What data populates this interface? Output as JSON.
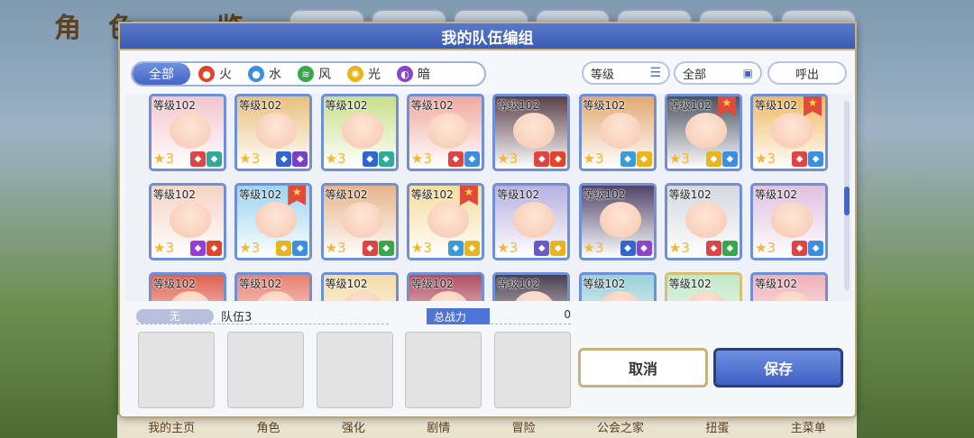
{
  "background": {
    "title": "角色一览",
    "nav": [
      "我的主页",
      "角色",
      "强化",
      "剧情",
      "冒险",
      "公会之家",
      "扭蛋",
      "主菜单"
    ]
  },
  "modal": {
    "title": "我的队伍编组",
    "elements": [
      {
        "label": "全部",
        "active": true
      },
      {
        "label": "火",
        "icon": "fire-icon",
        "color": "#e0452c"
      },
      {
        "label": "水",
        "icon": "water-icon",
        "color": "#3b8fe0"
      },
      {
        "label": "风",
        "icon": "wind-icon",
        "color": "#38a84a"
      },
      {
        "label": "光",
        "icon": "light-icon",
        "color": "#e8b420"
      },
      {
        "label": "暗",
        "icon": "dark-icon",
        "color": "#8a46c8"
      }
    ],
    "sort_label": "等级",
    "filter_label": "全部",
    "call_label": "呼出",
    "level_label": "等级102",
    "star_count": "3",
    "team_none": "无",
    "team_name": "队伍3",
    "power_label": "总战力",
    "power_value": "0",
    "cancel_label": "取消",
    "save_label": "保存"
  },
  "characters": [
    {
      "frame": "#6f8fd6",
      "bg": "#f2c6cf",
      "b": [
        "#d44",
        "#3a9"
      ],
      "flag": false
    },
    {
      "frame": "#6f8fd6",
      "bg": "#e8c07a",
      "b": [
        "#36c",
        "#7a3fc9"
      ],
      "flag": false
    },
    {
      "frame": "#6f8fd6",
      "bg": "#c8e08a",
      "b": [
        "#36c",
        "#3a9"
      ],
      "flag": false
    },
    {
      "frame": "#6f8fd6",
      "bg": "#f0a9a0",
      "b": [
        "#d44",
        "#3b8fe0"
      ],
      "flag": false
    },
    {
      "frame": "#6f8fd6",
      "bg": "#5a4048",
      "b": [
        "#d44",
        "#e0452c"
      ],
      "flag": false
    },
    {
      "frame": "#6f8fd6",
      "bg": "#e2a870",
      "b": [
        "#3a9bd8",
        "#e8b420"
      ],
      "flag": false
    },
    {
      "frame": "#6f8fd6",
      "bg": "#49515e",
      "b": [
        "#e8b420",
        "#3b8fe0"
      ],
      "flag": true
    },
    {
      "frame": "#6f8fd6",
      "bg": "#f0b860",
      "b": [
        "#d44",
        "#3b8fe0"
      ],
      "flag": true
    },
    {
      "frame": "#6f8fd6",
      "bg": "#f5d4c4",
      "b": [
        "#9a3bd8",
        "#e0452c"
      ],
      "flag": false
    },
    {
      "frame": "#6f8fd6",
      "bg": "#9ad4f0",
      "b": [
        "#e8b420",
        "#3b8fe0"
      ],
      "flag": true
    },
    {
      "frame": "#6f8fd6",
      "bg": "#e6b48a",
      "b": [
        "#d44",
        "#38a84a"
      ],
      "flag": false
    },
    {
      "frame": "#6f8fd6",
      "bg": "#f5dc9a",
      "b": [
        "#3a9bd8",
        "#e8b420"
      ],
      "flag": true
    },
    {
      "frame": "#6f8fd6",
      "bg": "#b6b0e0",
      "b": [
        "#6a5ac8",
        "#e8b420"
      ],
      "flag": false
    },
    {
      "frame": "#6f8fd6",
      "bg": "#504468",
      "b": [
        "#36c",
        "#8a46c8"
      ],
      "flag": false
    },
    {
      "frame": "#6f8fd6",
      "bg": "#d4d8e0",
      "b": [
        "#d44",
        "#38a84a"
      ],
      "flag": false
    },
    {
      "frame": "#6f8fd6",
      "bg": "#e0c0e0",
      "b": [
        "#d44",
        "#3b8fe0"
      ],
      "flag": false
    },
    {
      "frame": "#6f8fd6",
      "bg": "#e06050",
      "b": [],
      "flag": false
    },
    {
      "frame": "#6f8fd6",
      "bg": "#e88070",
      "b": [],
      "flag": false
    },
    {
      "frame": "#6f8fd6",
      "bg": "#f5dca8",
      "b": [],
      "flag": false
    },
    {
      "frame": "#6f8fd6",
      "bg": "#b05060",
      "b": [],
      "flag": false
    },
    {
      "frame": "#6f8fd6",
      "bg": "#4a4050",
      "b": [],
      "flag": false
    },
    {
      "frame": "#6f8fd6",
      "bg": "#9ad0d8",
      "b": [],
      "flag": false
    },
    {
      "frame": "#d8c070",
      "bg": "#c0e8c8",
      "b": [],
      "flag": false
    },
    {
      "frame": "#6f8fd6",
      "bg": "#f0b0b8",
      "b": [],
      "flag": false
    }
  ]
}
